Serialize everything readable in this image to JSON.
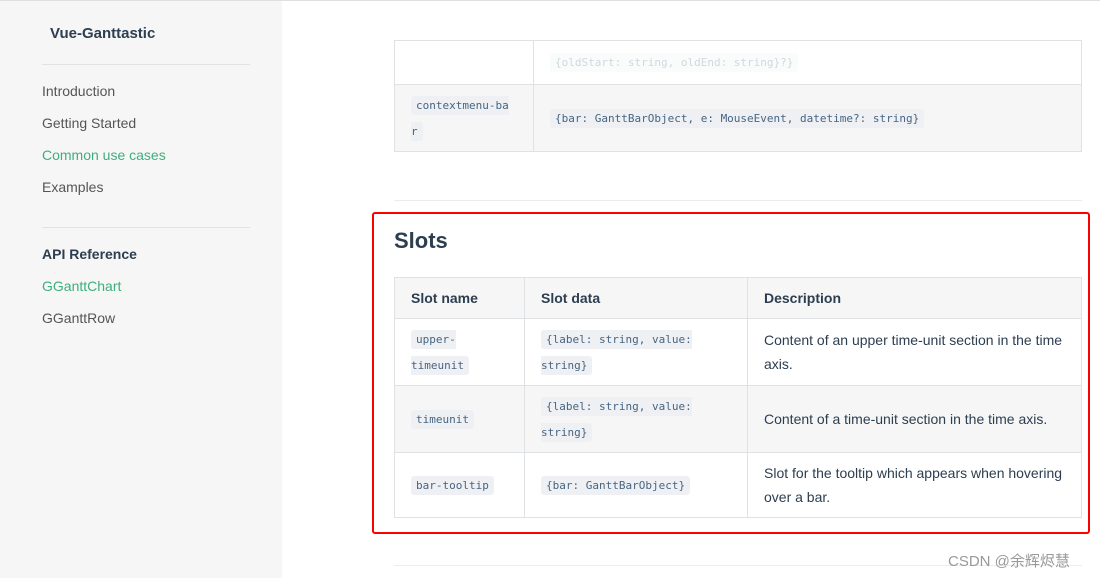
{
  "sidebar": {
    "brand": "Vue-Ganttastic",
    "items": [
      {
        "label": "Introduction"
      },
      {
        "label": "Getting Started"
      },
      {
        "label": "Common use cases"
      },
      {
        "label": "Examples"
      }
    ],
    "api_heading": "API Reference",
    "api_items": [
      {
        "label": "GGanttChart"
      },
      {
        "label": "GGanttRow"
      }
    ]
  },
  "events_table": {
    "rows": [
      {
        "name": "",
        "data": "{oldStart: string, oldEnd: string}?}"
      },
      {
        "name": "contextmenu-bar",
        "data": "{bar: GanttBarObject, e: MouseEvent, datetime?: string}"
      }
    ]
  },
  "slots": {
    "title": "Slots",
    "headers": [
      "Slot name",
      "Slot data",
      "Description"
    ],
    "rows": [
      {
        "name": "upper-timeunit",
        "data": "{label: string, value: string}",
        "desc": "Content of an upper time-unit section in the time axis."
      },
      {
        "name": "timeunit",
        "data": "{label: string, value: string}",
        "desc": "Content of a time-unit section in the time axis."
      },
      {
        "name": "bar-tooltip",
        "data": "{bar: GanttBarObject}",
        "desc": "Slot for the tooltip which appears when hovering over a bar."
      }
    ]
  },
  "watermark": "CSDN @余辉烬慧",
  "colors": {
    "accent": "#3eaf7c",
    "highlight_box": "#ff0000"
  }
}
